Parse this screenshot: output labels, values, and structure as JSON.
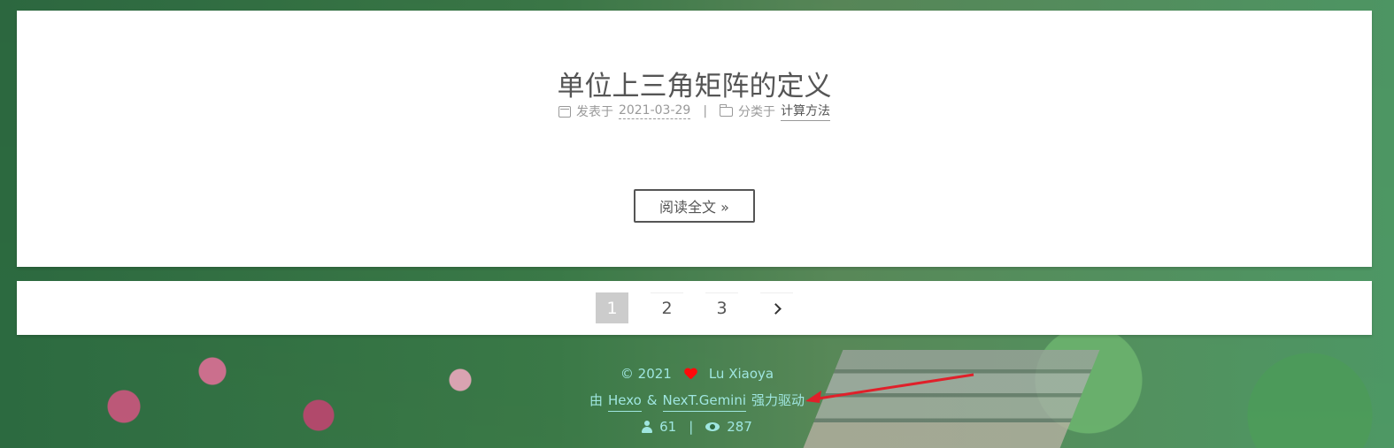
{
  "post": {
    "title": "单位上三角矩阵的定义",
    "published_label": "发表于",
    "published_date": "2021-03-29",
    "separator": "|",
    "category_label": "分类于",
    "category": "计算方法",
    "read_more": "阅读全文 »"
  },
  "pagination": {
    "pages": [
      "1",
      "2",
      "3"
    ],
    "current": "1",
    "next_icon": "chevron-right-icon"
  },
  "footer": {
    "copyright_year": "© 2021",
    "author": "Lu Xiaoya",
    "powered_prefix": "由",
    "hexo": "Hexo",
    "amp": "&",
    "theme": "NexT.Gemini",
    "powered_suffix": "强力驱动",
    "visitors": "61",
    "stat_sep": "|",
    "views": "287"
  },
  "colors": {
    "footer_text": "#9fe6e0",
    "heart": "#ff0a0a",
    "annotation_arrow": "#e0202a"
  }
}
